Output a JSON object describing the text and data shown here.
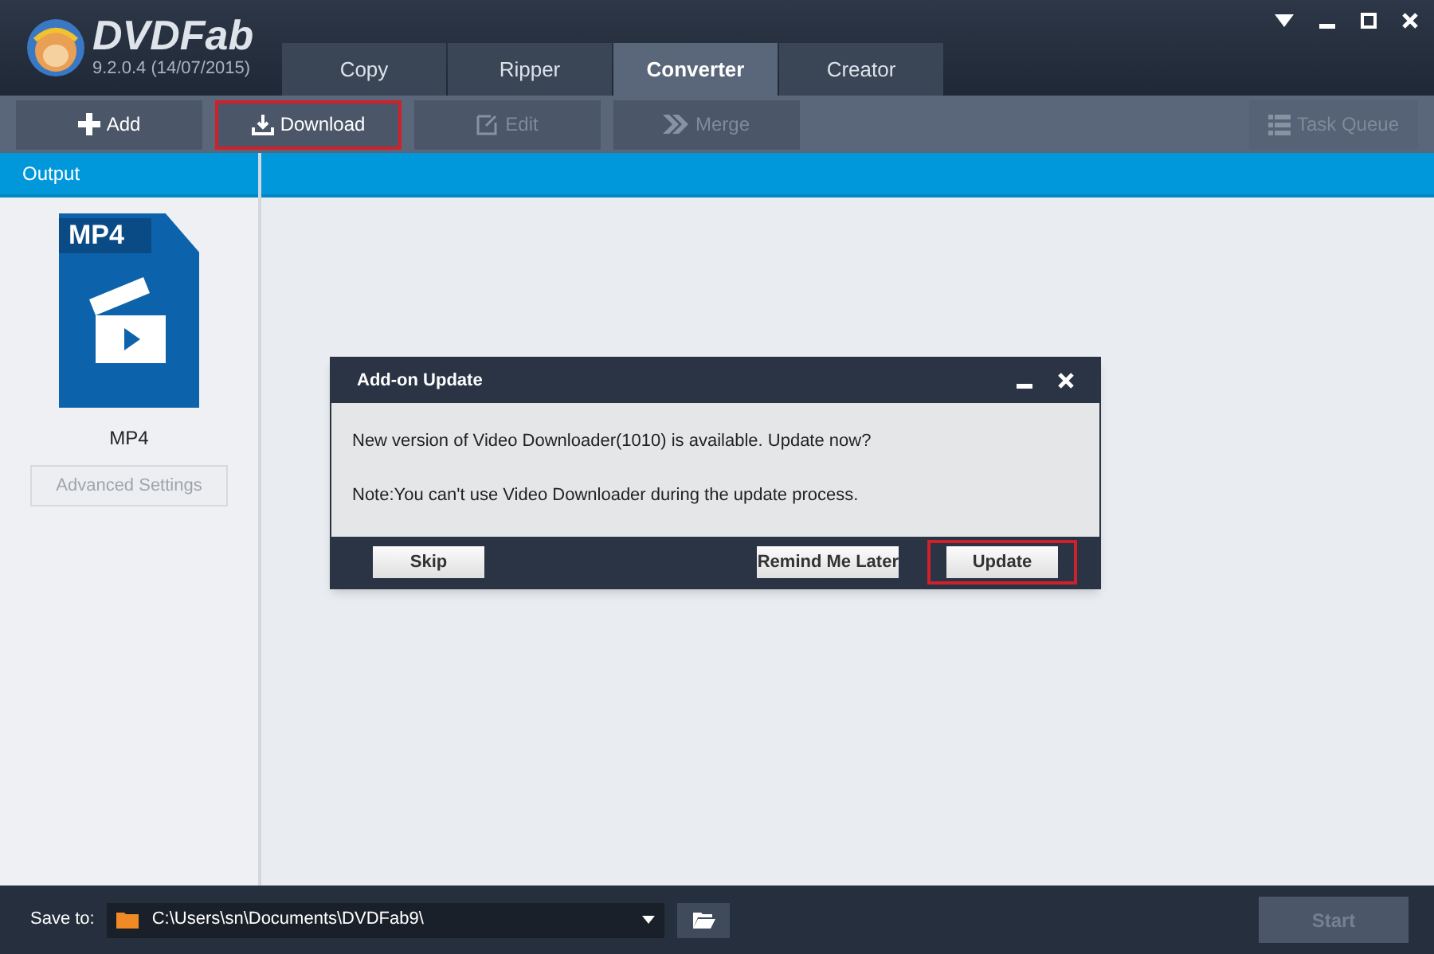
{
  "app": {
    "name": "DVDFab",
    "version": "9.2.0.4 (14/07/2015)"
  },
  "tabs": [
    {
      "label": "Copy",
      "selected": false
    },
    {
      "label": "Ripper",
      "selected": false
    },
    {
      "label": "Converter",
      "selected": true
    },
    {
      "label": "Creator",
      "selected": false
    }
  ],
  "toolbar": [
    {
      "kind": "add",
      "label": "Add",
      "disabled": false,
      "highlighted": false
    },
    {
      "kind": "download",
      "label": "Download",
      "disabled": false,
      "highlighted": true
    },
    {
      "kind": "edit",
      "label": "Edit",
      "disabled": true,
      "highlighted": false
    },
    {
      "kind": "merge",
      "label": "Merge",
      "disabled": true,
      "highlighted": false
    }
  ],
  "task_queue": {
    "label": "Task Queue",
    "disabled": true
  },
  "output": {
    "header": "Output",
    "format_badge": "MP4",
    "format_label": "MP4",
    "advanced_button": {
      "label": "Advanced Settings",
      "disabled": true
    }
  },
  "dialog": {
    "title": "Add-on Update",
    "message": "New version of Video Downloader(1010) is available. Update now?",
    "note": "Note:You can't use Video Downloader during the update process.",
    "buttons": [
      {
        "label": "Skip",
        "highlighted": false
      },
      {
        "label": "Remind Me Later",
        "highlighted": false
      },
      {
        "label": "Update",
        "highlighted": true
      }
    ]
  },
  "status_bar": {
    "save_label": "Save to:",
    "path": "C:\\Users\\sn\\Documents\\DVDFab9\\",
    "start": {
      "label": "Start",
      "disabled": true
    }
  }
}
